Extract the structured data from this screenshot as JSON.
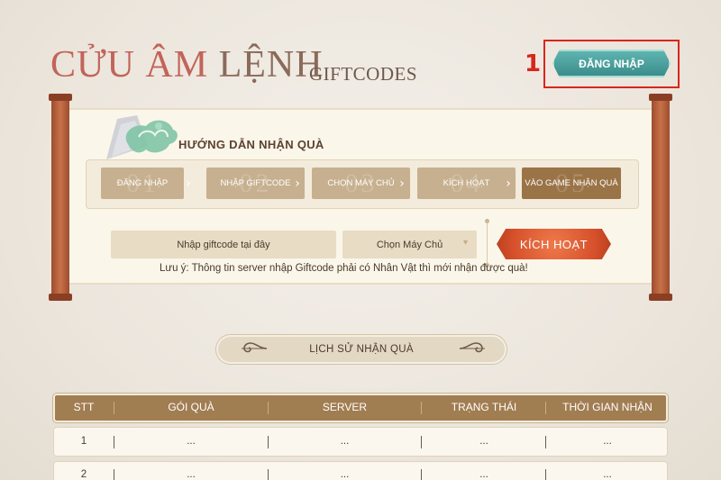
{
  "header": {
    "title_part1": "CỬU ÂM",
    "title_part2": "LỆNH",
    "subtitle": "GIFTCODES",
    "annotation_number": "1",
    "login_label": "ĐĂNG NHẬP"
  },
  "guide": {
    "title": "HƯỚNG DẪN NHẬN QUÀ",
    "steps": [
      {
        "number": "01",
        "label": "ĐĂNG NHẬP"
      },
      {
        "number": "02",
        "label": "NHẬP GIFTCODE"
      },
      {
        "number": "03",
        "label": "CHỌN MÁY CHỦ"
      },
      {
        "number": "04",
        "label": "KÍCH HOẠT"
      },
      {
        "number": "05",
        "label": "VÀO GAME NHẬN QUÀ"
      }
    ],
    "code_input_placeholder": "Nhập giftcode tại đây",
    "server_select_value": "Chọn Máy Chủ",
    "activate_label": "KÍCH HOẠT",
    "note": "Lưu ý: Thông tin server nhập Giftcode phải có Nhân Vật thì mới nhận được quà!"
  },
  "history": {
    "title": "LỊCH SỬ NHẬN QUÀ",
    "columns": [
      "STT",
      "GÓI QUÀ",
      "SERVER",
      "TRẠNG THÁI",
      "THỜI GIAN NHẬN"
    ],
    "rows": [
      [
        "1",
        "...",
        "...",
        "...",
        "..."
      ],
      [
        "2",
        "...",
        "...",
        "...",
        "..."
      ]
    ]
  },
  "colors": {
    "accent_title": "#c2645a",
    "login_button": "#3b8d8b",
    "activate_button": "#d6502b",
    "table_header": "#a17d52",
    "annotation": "#d8261c"
  },
  "icons": [
    "dragon-emblem-icon",
    "chevron-right-icon",
    "swirl-ornament-icon",
    "dropdown-arrow-icon"
  ]
}
